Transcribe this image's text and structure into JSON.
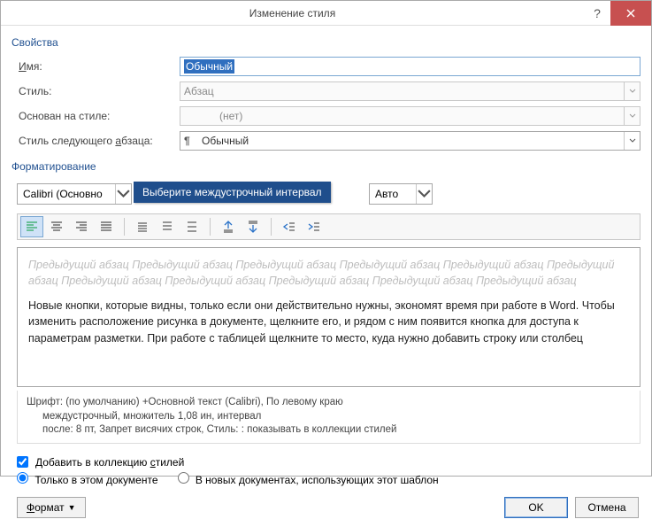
{
  "titlebar": {
    "title": "Изменение стиля"
  },
  "group": {
    "properties": "Свойства",
    "formatting": "Форматирование"
  },
  "labels": {
    "name": "Имя:",
    "style": "Стиль:",
    "based_on": "Основан на стиле:",
    "next_style": "Стиль следующего абзаца:"
  },
  "values": {
    "name": "Обычный",
    "style": "Абзац",
    "based_on": "(нет)",
    "next_style": "Обычный"
  },
  "formatting": {
    "font": "Calibri (Основно",
    "color_mode": "Авто",
    "tooltip": "Выберите междустрочный интервал"
  },
  "icons": {
    "align_left": "align-left-icon",
    "align_center": "align-center-icon",
    "align_right": "align-right-icon",
    "align_justify": "align-justify-icon",
    "line_sp_1": "line-spacing-1-icon",
    "line_sp_15": "line-spacing-15-icon",
    "line_sp_2": "line-spacing-2-icon",
    "space_before": "space-before-icon",
    "space_after": "space-after-icon",
    "indent_dec": "decrease-indent-icon",
    "indent_inc": "increase-indent-icon"
  },
  "preview": {
    "ghost": "Предыдущий абзац Предыдущий абзац Предыдущий абзац Предыдущий абзац Предыдущий абзац Предыдущий абзац Предыдущий абзац Предыдущий абзац Предыдущий абзац Предыдущий абзац Предыдущий абзац",
    "sample": "Новые кнопки, которые видны, только если они действительно нужны, экономят время при работе в Word. Чтобы изменить расположение рисунка в документе, щелкните его, и рядом с ним появится кнопка для доступа к параметрам разметки.  При работе с таблицей щелкните то место, куда нужно добавить строку или столбец"
  },
  "description": {
    "l1": "Шрифт: (по умолчанию) +Основной текст (Calibri), По левому краю",
    "l2": "междустрочный,  множитель 1,08 ин, интервал",
    "l3": "после: 8 пт, Запрет висячих строк, Стиль: : показывать в коллекции стилей"
  },
  "options": {
    "add_to_gallery": "Добавить в коллекцию стилей",
    "only_this_doc": "Только в этом документе",
    "new_docs_template": "В новых документах, использующих этот шаблон"
  },
  "buttons": {
    "format": "Формат",
    "ok": "OK",
    "cancel": "Отмена"
  }
}
